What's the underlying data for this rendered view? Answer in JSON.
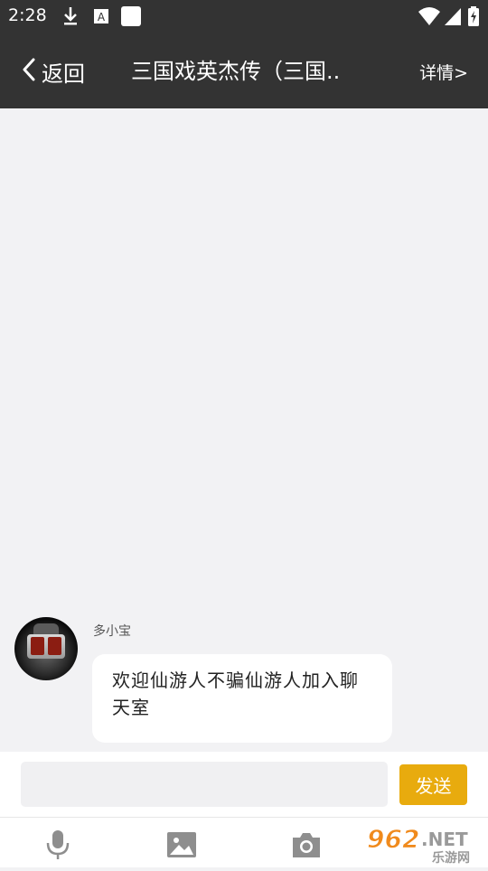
{
  "status_bar": {
    "time": "2:28",
    "icons": [
      "download-icon",
      "a-box-icon",
      "blank-square-icon",
      "wifi-icon",
      "signal-icon",
      "battery-icon"
    ]
  },
  "nav": {
    "back_label": "返回",
    "title": "三国戏英杰传（三国..",
    "detail_label": "详情>"
  },
  "chat": {
    "messages": [
      {
        "sender": "多小宝",
        "avatar": "robot-avatar",
        "text": "欢迎仙游人不骗仙游人加入聊天室"
      }
    ]
  },
  "input": {
    "value": "",
    "placeholder": "",
    "send_label": "发送"
  },
  "toolbar": {
    "items": [
      "microphone-icon",
      "image-icon",
      "camera-icon"
    ]
  },
  "watermark": {
    "brand_number": "962",
    "brand_suffix": ".NET",
    "brand_sub": "乐游网"
  },
  "colors": {
    "header_bg": "#333333",
    "chat_bg": "#f2f2f4",
    "send_button": "#e8ab0e",
    "bubble_bg": "#ffffff"
  }
}
